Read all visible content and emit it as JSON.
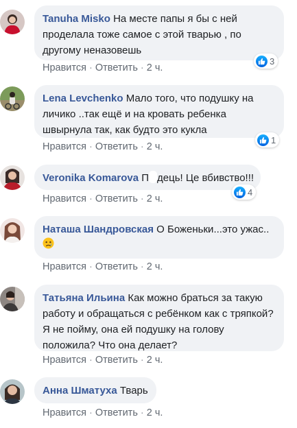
{
  "comments": [
    {
      "author": "Tanuha Misko",
      "text": "На месте папы я бы с ней проделала тоже самое с этой тварью , по другому неназовешь",
      "like_label": "Нравится",
      "reply_label": "Ответить",
      "time": "2 ч.",
      "reactions": "3"
    },
    {
      "author": "Lena Levchenko",
      "text": "Мало того, что подушку на личико ..так ещё и на кровать ребенка швырнула так, как будто это кукла",
      "like_label": "Нравится",
      "reply_label": "Ответить",
      "time": "2 ч.",
      "reactions": "1"
    },
    {
      "author": "Veronika Komarova",
      "text_prefix": "П",
      "text": "дець! Це вбивство!!!",
      "like_label": "Нравится",
      "reply_label": "Ответить",
      "time": "2 ч.",
      "reactions": "4"
    },
    {
      "author": "Наташа Шандровская",
      "text": "О Боженьки...это ужас..",
      "emoji": "sad-face-emoji",
      "like_label": "Нравится",
      "reply_label": "Ответить",
      "time": "2 ч."
    },
    {
      "author": "Татьяна Ильина",
      "text": "Как можно браться за такую работу и обращаться с ребёнком как с тряпкой? Я не пойму, она ей подушку на голову положила? Что она делает?",
      "like_label": "Нравится",
      "reply_label": "Ответить",
      "time": "2 ч."
    },
    {
      "author": "Анна Шматуха",
      "text": "Тварь",
      "like_label": "Нравится",
      "reply_label": "Ответить",
      "time": "2 ч."
    }
  ],
  "colors": {
    "author": "#385898",
    "bubble": "#f0f2f5",
    "meta": "#606770",
    "like_blue": "#1877f2"
  },
  "icons": {
    "reaction": "like-thumb-icon",
    "emoji": "sad-face-emoji"
  }
}
